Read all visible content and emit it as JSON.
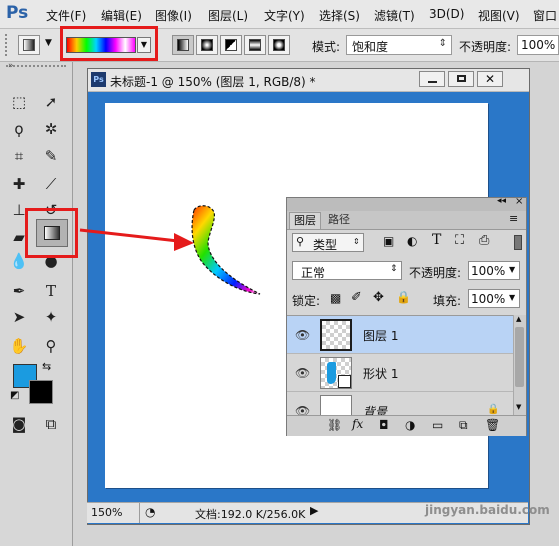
{
  "app": {
    "logo": "Ps"
  },
  "menu": [
    "文件(F)",
    "编辑(E)",
    "图像(I)",
    "图层(L)",
    "文字(Y)",
    "选择(S)",
    "滤镜(T)",
    "3D(D)",
    "视图(V)",
    "窗口"
  ],
  "options": {
    "mode_label": "模式:",
    "mode_value": "饱和度",
    "opacity_label": "不透明度:",
    "opacity_value": "100%"
  },
  "document": {
    "title": "未标题-1 @ 150% (图层 1, RGB/8) *",
    "zoom": "150%",
    "doc_info": "文档:192.0 K/256.0K"
  },
  "layers_panel": {
    "tabs": [
      "图层",
      "路径"
    ],
    "filter_kind": "类型",
    "blend_mode": "正常",
    "opacity_label": "不透明度:",
    "opacity_value": "100%",
    "lock_label": "锁定:",
    "fill_label": "填充:",
    "fill_value": "100%",
    "layers": [
      {
        "name": "图层 1",
        "selected": true
      },
      {
        "name": "形状 1",
        "selected": false
      },
      {
        "name": "背景",
        "selected": false
      }
    ]
  },
  "watermark": "jingyan.baidu.com",
  "colors": {
    "foreground": "#1b9be0",
    "background": "#000000",
    "canvas_frame": "#2a77c8",
    "highlight": "#e51b1b",
    "selected_layer": "#b9d3f5"
  }
}
